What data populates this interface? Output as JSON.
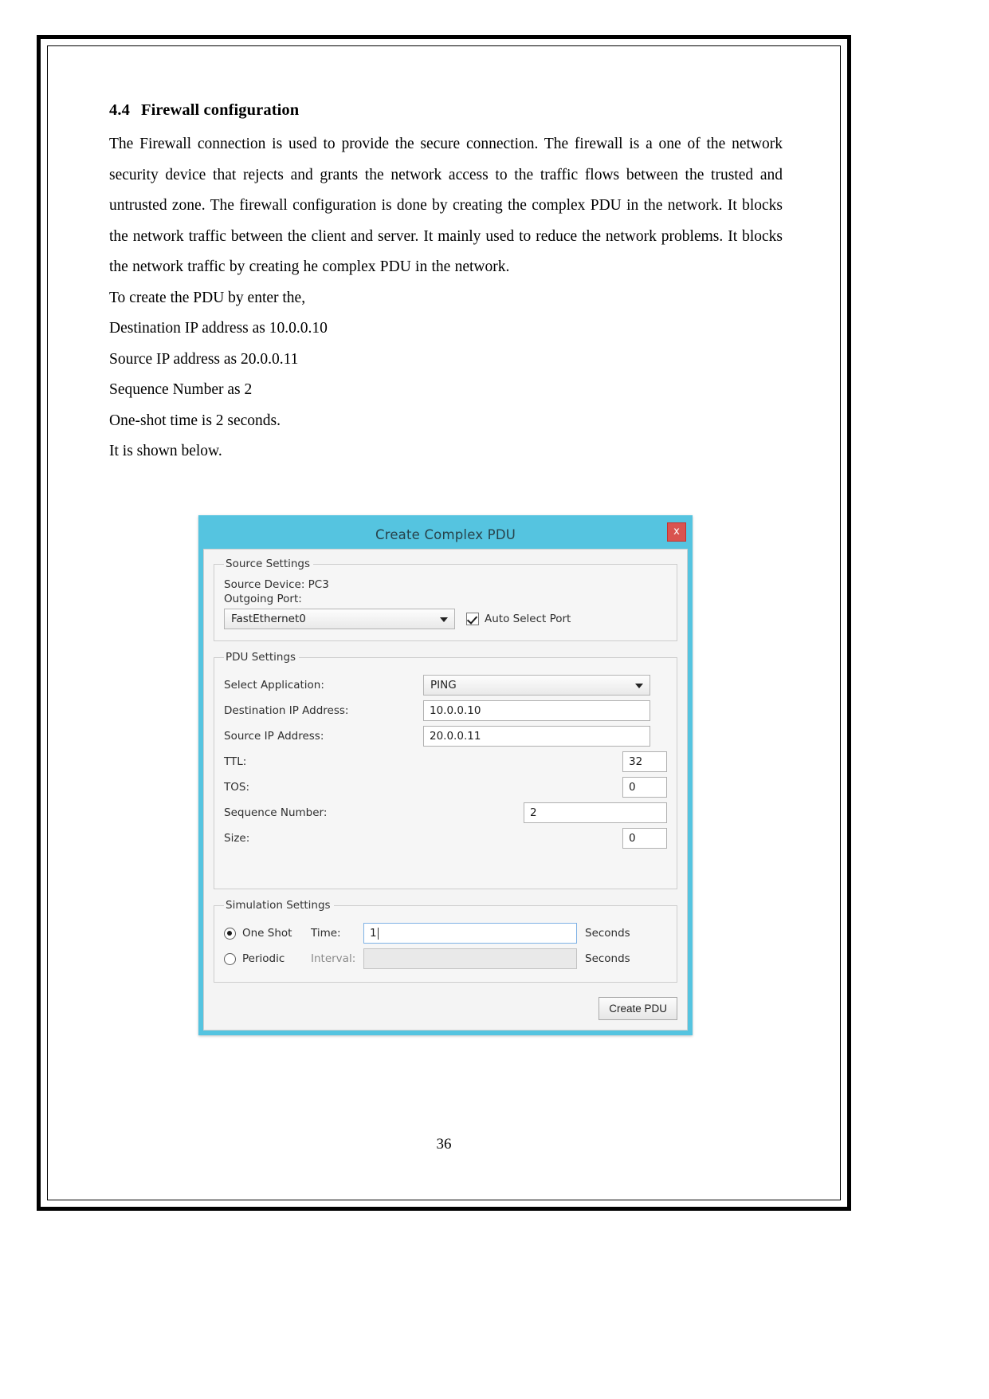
{
  "document": {
    "section_number": "4.4",
    "section_title": "Firewall configuration",
    "paragraph": "The Firewall connection is used to provide the secure connection. The firewall is a one of the network security device that rejects and grants the network access to the traffic flows between the trusted and untrusted zone. The firewall configuration is done by creating the complex PDU in the network. It blocks the network traffic between the client and server. It mainly used to reduce the network problems. It blocks the network traffic by creating he complex PDU in the network.",
    "lines": [
      "To create the PDU by enter the,",
      "Destination IP address as 10.0.0.10",
      "Source IP address as 20.0.0.11",
      "Sequence Number as 2",
      "One-shot time is 2 seconds.",
      "It is shown below."
    ],
    "page_number": "36"
  },
  "dialog": {
    "title": "Create Complex PDU",
    "close_label": "x",
    "titlebar_color": "#55c4e0",
    "close_color": "#d9534f",
    "source_settings": {
      "legend": "Source Settings",
      "source_device_label": "Source Device: PC3",
      "outgoing_port_label": "Outgoing Port:",
      "outgoing_port_value": "FastEthernet0",
      "auto_select_port_label": "Auto Select Port",
      "auto_select_port_checked": true
    },
    "pdu_settings": {
      "legend": "PDU Settings",
      "fields": [
        {
          "label": "Select Application:",
          "value": "PING",
          "kind": "combo"
        },
        {
          "label": "Destination IP Address:",
          "value": "10.0.0.10",
          "kind": "text-wide"
        },
        {
          "label": "Source IP Address:",
          "value": "20.0.0.11",
          "kind": "text-wide"
        },
        {
          "label": "TTL:",
          "value": "32",
          "kind": "text-small"
        },
        {
          "label": "TOS:",
          "value": "0",
          "kind": "text-small"
        },
        {
          "label": "Sequence Number:",
          "value": "2",
          "kind": "text-medium"
        },
        {
          "label": "Size:",
          "value": "0",
          "kind": "text-small"
        }
      ]
    },
    "simulation_settings": {
      "legend": "Simulation Settings",
      "one_shot_label": "One Shot",
      "one_shot_selected": true,
      "time_label": "Time:",
      "time_value": "1",
      "time_units": "Seconds",
      "periodic_label": "Periodic",
      "periodic_selected": false,
      "interval_label": "Interval:",
      "interval_value": "",
      "interval_units": "Seconds"
    },
    "create_button_label": "Create PDU"
  }
}
